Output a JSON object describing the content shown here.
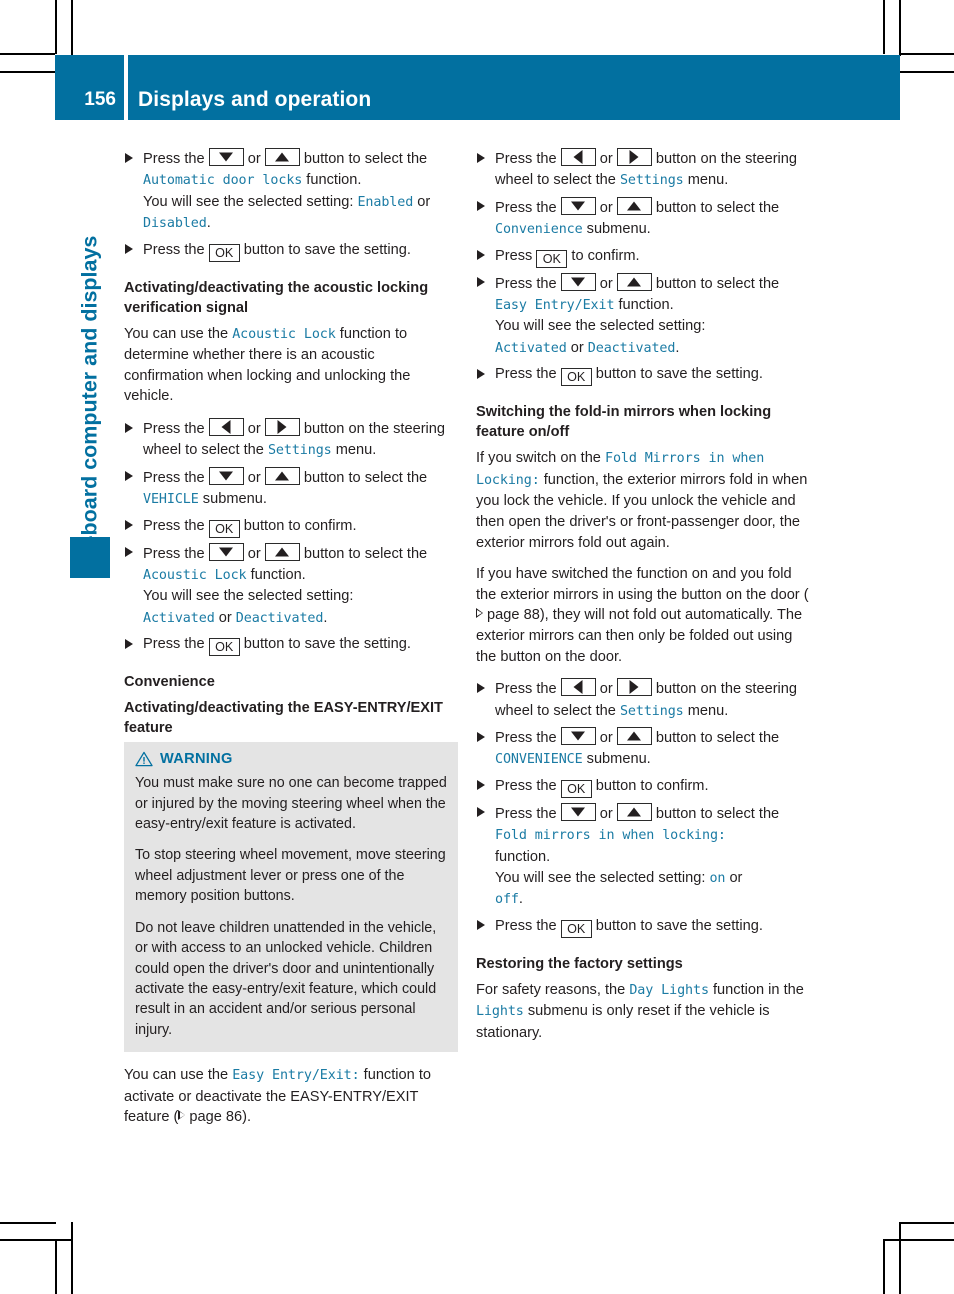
{
  "header": {
    "page_number": "156",
    "title": "Displays and operation"
  },
  "chapter_tab": {
    "label": "On-board computer and displays"
  },
  "colors": {
    "accent_blue": "#0270a0",
    "mono_blue": "#1b7ba4",
    "warning_bg": "#e4e4e4"
  },
  "keys": {
    "down": "down-arrow-key",
    "up": "up-arrow-key",
    "left": "left-arrow-key",
    "right": "right-arrow-key",
    "ok": "OK"
  },
  "left_column": {
    "step_auto_door_locks": {
      "t1": "Press the ",
      "or": " or ",
      "t2": " button to select the ",
      "fn": "Automatic door locks",
      "t3": " function.",
      "t4": "You will see the selected setting: ",
      "val1": "Enabled",
      "t5": " or ",
      "val2": "Disabled",
      "t6": "."
    },
    "step_save": {
      "t1": "Press the ",
      "t2": " button to save the setting."
    },
    "heading_acoustic": "Activating/deactivating the acoustic locking verification signal",
    "para_acoustic": {
      "t1": "You can use the ",
      "fn": "Acoustic Lock",
      "t2": " function to determine whether there is an acoustic confirmation when locking and unlocking the vehicle."
    },
    "step_settings": {
      "t1": "Press the ",
      "or": " or ",
      "t2": " button on the steering wheel to select the ",
      "fn": "Settings",
      "t3": " menu."
    },
    "step_vehicle": {
      "t1": "Press the ",
      "or": " or ",
      "t2": " button to select the ",
      "fn": "VEHICLE",
      "t3": " submenu."
    },
    "step_confirm": {
      "t1": "Press the ",
      "t2": " button to confirm."
    },
    "step_acoustic_lock": {
      "t1": "Press the ",
      "or": " or ",
      "t2": " button to select the ",
      "fn": "Acoustic Lock",
      "t3": " function.",
      "t4": "You will see the selected setting:",
      "val1": "Activated",
      "t5": " or ",
      "val2": "Deactivated",
      "t6": "."
    },
    "heading_convenience": "Convenience",
    "heading_easy_entry": "Activating/deactivating the EASY-ENTRY/EXIT feature",
    "warning": {
      "label": "WARNING",
      "icon": "warning-triangle-icon",
      "paragraphs": [
        "You must make sure no one can become trapped or injured by the moving steering wheel when the easy-entry/exit feature is activated.",
        "To stop steering wheel movement, move steering wheel adjustment lever or press one of the memory position buttons.",
        "Do not leave children unattended in the vehicle, or with access to an unlocked vehicle. Children could open the driver's door and unintentionally activate the easy-entry/exit feature, which could result in an accident and/or serious personal injury."
      ]
    },
    "para_easy_entry": {
      "t1": "You can use the ",
      "fn": "Easy Entry/Exit:",
      "t2": " function to activate or deactivate the EASY-ENTRY/EXIT feature (",
      "ref": " page 86",
      "t3": ")."
    }
  },
  "right_column": {
    "step_settings": {
      "t1": "Press the ",
      "or": " or ",
      "t2": " button on the steering wheel to select the ",
      "fn": "Settings",
      "t3": " menu."
    },
    "step_convenience": {
      "t1": "Press the ",
      "or": " or ",
      "t2": " button to select the ",
      "fn": "Convenience",
      "t3": " submenu."
    },
    "step_press_ok_confirm": {
      "t1": "Press ",
      "t2": " to confirm."
    },
    "step_easy_entry": {
      "t1": "Press the ",
      "or": " or ",
      "t2": " button to select the ",
      "fn": "Easy Entry/Exit",
      "t3": " function.",
      "t4": "You will see the selected setting:",
      "val1": "Activated",
      "t5": " or ",
      "val2": "Deactivated",
      "t6": "."
    },
    "step_save": {
      "t1": "Press the ",
      "t2": " button to save the setting."
    },
    "heading_fold_mirrors": "Switching the fold-in mirrors when locking feature on/off",
    "para_fold_1": {
      "t1": "If you switch on the ",
      "fn": "Fold Mirrors in when Locking:",
      "t2": " function, the exterior mirrors fold in when you lock the vehicle. If you unlock the vehicle and then open the driver's or front-passenger door, the exterior mirrors fold out again."
    },
    "para_fold_2": {
      "t1": "If you have switched the function on and you fold the exterior mirrors in using the button on the door (",
      "ref": " page 88",
      "t2": "), they will not fold out automatically. The exterior mirrors can then only be folded out using the button on the door."
    },
    "step_convenience_caps": {
      "t1": "Press the ",
      "or": " or ",
      "t2": " button to select the ",
      "fn": "CONVENIENCE",
      "t3": " submenu."
    },
    "step_confirm": {
      "t1": "Press the ",
      "t2": " button to confirm."
    },
    "step_fold_mirrors_fn": {
      "t1": "Press the ",
      "or": " or ",
      "t2": " button to select the ",
      "fn": "Fold mirrors in when locking:",
      "t3": "function.",
      "t4": "You will see the selected setting: ",
      "val1": "on",
      "t5": " or ",
      "val2": "off",
      "t6": "."
    },
    "heading_restore": "Restoring the factory settings",
    "para_restore": {
      "t1": "For safety reasons, the ",
      "fn1": "Day Lights",
      "t2": " function in the ",
      "fn2": "Lights",
      "t3": " submenu is only reset if the vehicle is stationary."
    }
  }
}
